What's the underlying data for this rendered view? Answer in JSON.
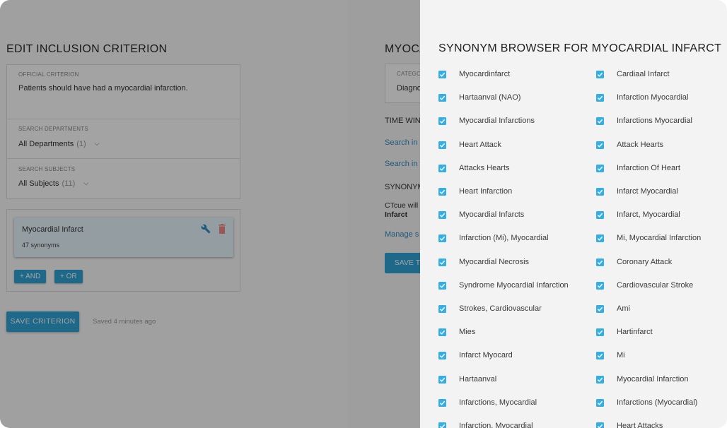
{
  "edit": {
    "title": "EDIT INCLUSION CRITERION",
    "official_criterion_label": "OFFICIAL CRITERION",
    "official_criterion_text": "Patients should have had a myocardial infarction.",
    "departments_label": "SEARCH DEPARTMENTS",
    "departments_value": "All Departments",
    "departments_count": "(1)",
    "subjects_label": "SEARCH SUBJECTS",
    "subjects_value": "All Subjects",
    "subjects_count": "(11)",
    "concept_name": "Myocardial Infarct",
    "concept_synonyms": "47 synonyms",
    "and_button": "+ AND",
    "or_button": "+ OR",
    "save_button": "SAVE CRITERION",
    "saved_note": "Saved 4 minutes ago"
  },
  "mid": {
    "title": "MYOCA",
    "category_label": "CATEGO",
    "category_value": "Diagno",
    "time_window": "TIME WIN",
    "link1": "Search in s",
    "link2": "Search in t",
    "synonyms_heading": "SYNONYM",
    "ctcue_text": "CTcue will",
    "infarct_text": "Infarct",
    "manage_link": "Manage s",
    "save_button": "SAVE TE"
  },
  "drawer": {
    "title": "SYNONYM BROWSER FOR MYOCARDIAL INFARCT",
    "checkbox_color": "#35aee3",
    "left_column": [
      "Myocardinfarct",
      "Hartaanval (NAO)",
      "Myocardial Infarctions",
      "Heart Attack",
      "Attacks Hearts",
      "Heart Infarction",
      "Myocardial Infarcts",
      "Infarction (Mi), Myocardial",
      "Myocardial Necrosis",
      "Syndrome Myocardial Infarction",
      "Strokes, Cardiovascular",
      "Mies",
      "Infarct Myocard",
      "Hartaanval",
      "Infarctions, Myocardial",
      "Infarction, Myocardial"
    ],
    "right_column": [
      "Cardiaal Infarct",
      "Infarction Myocardial",
      "Infarctions Myocardial",
      "Attack Hearts",
      "Infarction Of Heart",
      "Infarct Myocardial",
      "Infarct, Myocardial",
      "Mi, Myocardial Infarction",
      "Coronary Attack",
      "Cardiovascular Stroke",
      "Ami",
      "Hartinfarct",
      "Mi",
      "Myocardial Infarction",
      "Infarctions (Myocardial)",
      "Heart Attacks"
    ]
  }
}
